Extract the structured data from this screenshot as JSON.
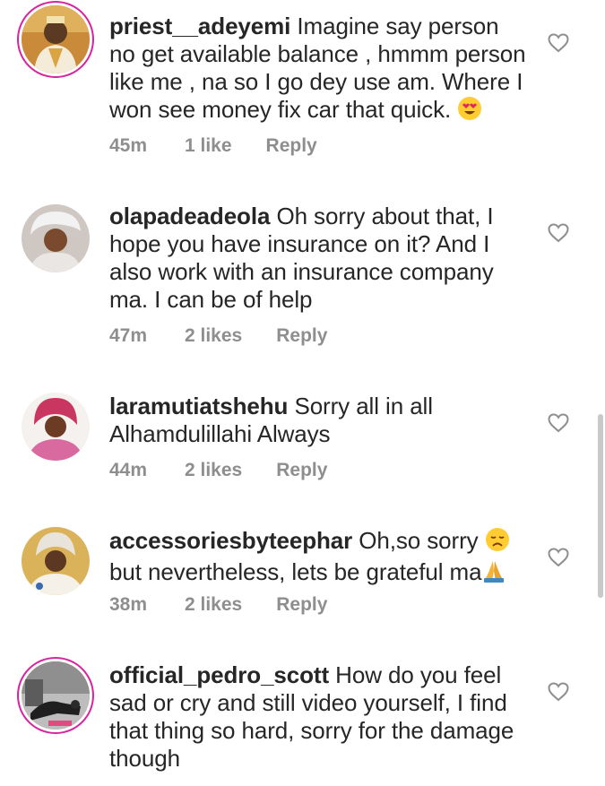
{
  "comments": [
    {
      "username": "priest__adeyemi",
      "text": " Imagine say person no get available balance , hmmm person like me , na so I go dey use am.  Where I won see money fix car that quick. ",
      "emoji": "heart-eyes-emoji",
      "time": "45m",
      "likes": "1 like",
      "reply": "Reply",
      "story_ring": true
    },
    {
      "username": "olapadeadeola",
      "text": " Oh sorry about that, I hope you have insurance on it? And I also work with an insurance company ma. I can be of help",
      "time": "47m",
      "likes": "2 likes",
      "reply": "Reply",
      "story_ring": false
    },
    {
      "username": "laramutiatshehu",
      "text": " Sorry  all in all Alhamdulillahi Always",
      "time": "44m",
      "likes": "2 likes",
      "reply": "Reply",
      "story_ring": false
    },
    {
      "username": "accessoriesbyteephar",
      "text_1": " Oh,so sorry ",
      "emoji_1": "disappointed-face-emoji",
      "text_2": " but nevertheless, lets be grateful ma",
      "emoji_2": "folded-hands-emoji",
      "time": "38m",
      "likes": "2 likes",
      "reply": "Reply",
      "story_ring": false
    },
    {
      "username": "official_pedro_scott",
      "text": " How do you feel sad or cry and still video yourself, I find that thing so hard, sorry for the damage though",
      "story_ring": true
    }
  ],
  "icons": {
    "like": "heart-outline-icon",
    "heart_color": "#8e8e8e"
  },
  "colors": {
    "text": "#262626",
    "meta": "#8e8e8e",
    "story_ring": "#d6249f"
  }
}
